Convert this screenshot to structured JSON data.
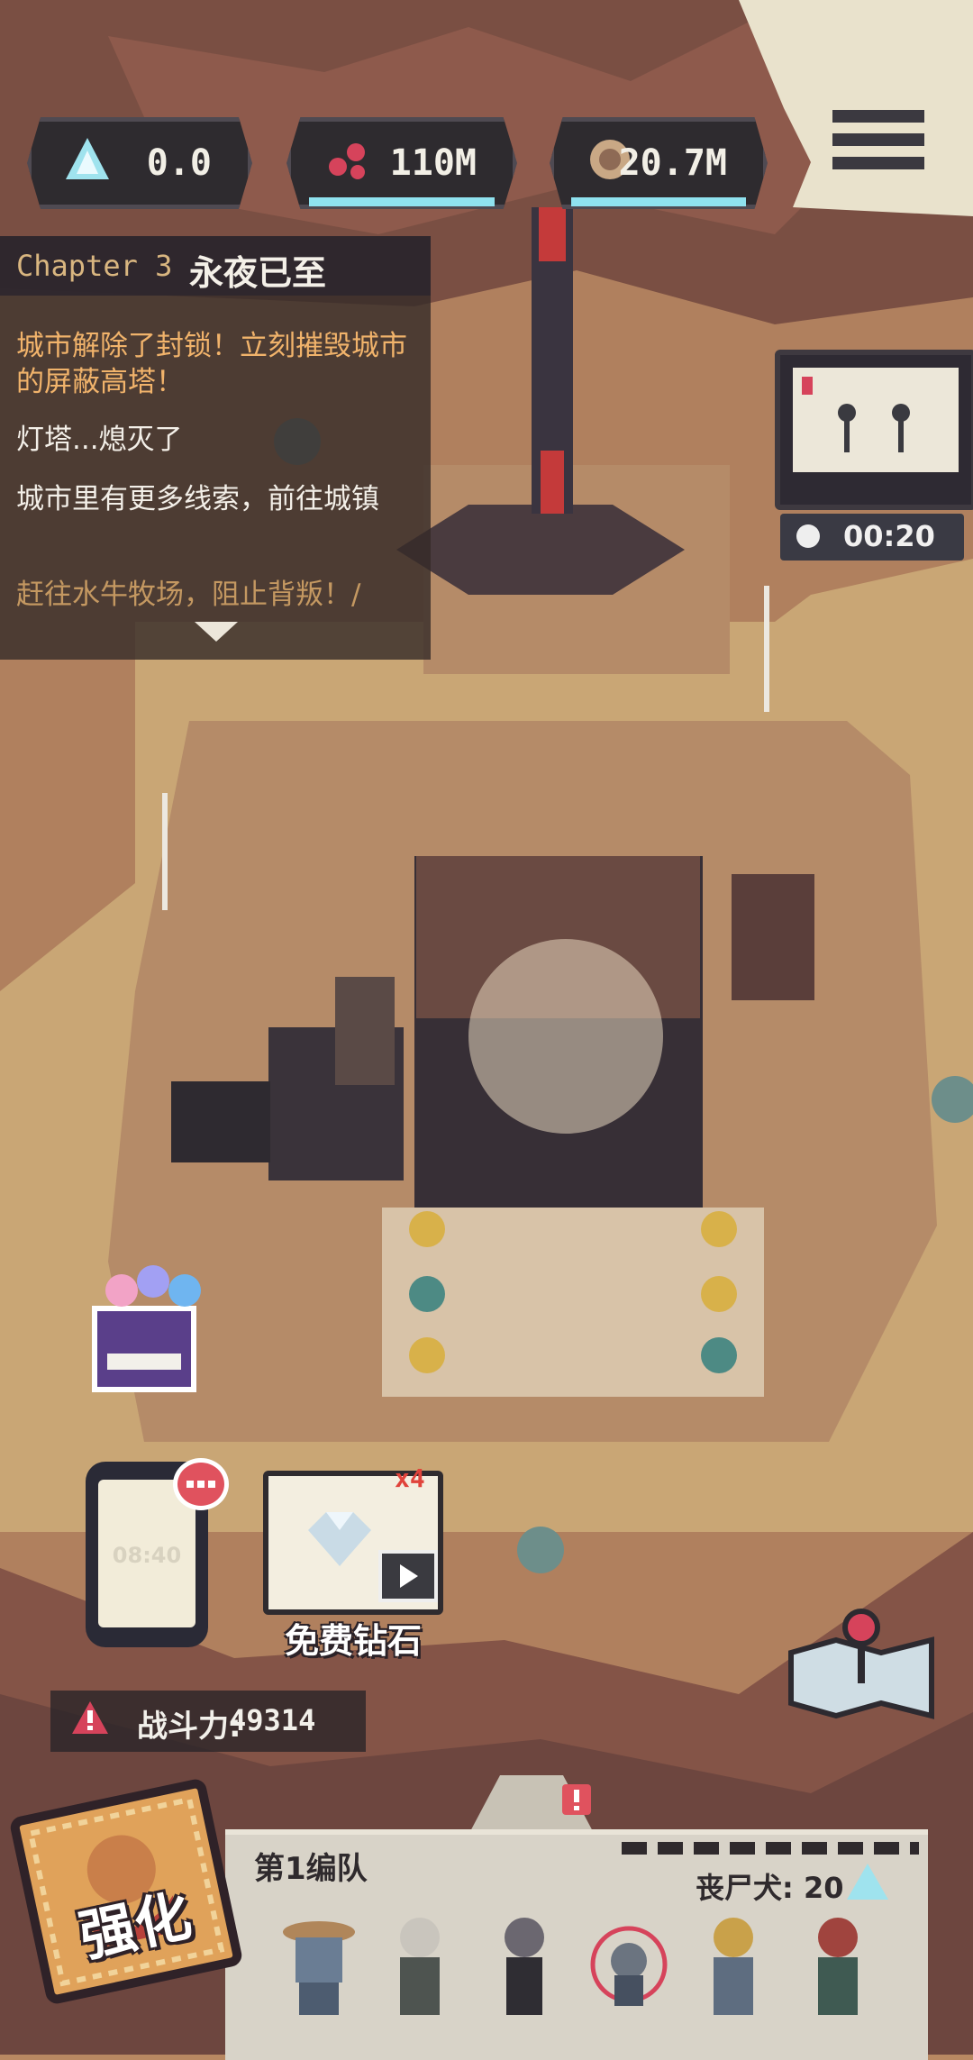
{
  "resources": [
    {
      "name": "crystal",
      "value": "0.0"
    },
    {
      "name": "parts",
      "value": "110M"
    },
    {
      "name": "coins",
      "value": "20.7M"
    }
  ],
  "quest": {
    "chapter": "Chapter 3",
    "title": "永夜已至",
    "lines": [
      "城市解除了封锁！立刻摧毁城市的屏蔽高塔！",
      "灯塔...熄灭了",
      "城市里有更多线索，前往城镇",
      "赶往水牛牧场，阻止背叛！/"
    ]
  },
  "mini_timer": "00:20",
  "phone_time": "08:40",
  "free_diamond": {
    "badge": "x4",
    "label": "免费钻石"
  },
  "power": {
    "label": "战斗力:",
    "value": "49314"
  },
  "enhance_label": "强化",
  "team": {
    "name": "第1编队",
    "dog_label": "丧尸犬: 20"
  },
  "colors": {
    "accent_cyan": "#8fe2ef",
    "badge_red": "#e0525e",
    "text_orange": "#f1b36b"
  }
}
